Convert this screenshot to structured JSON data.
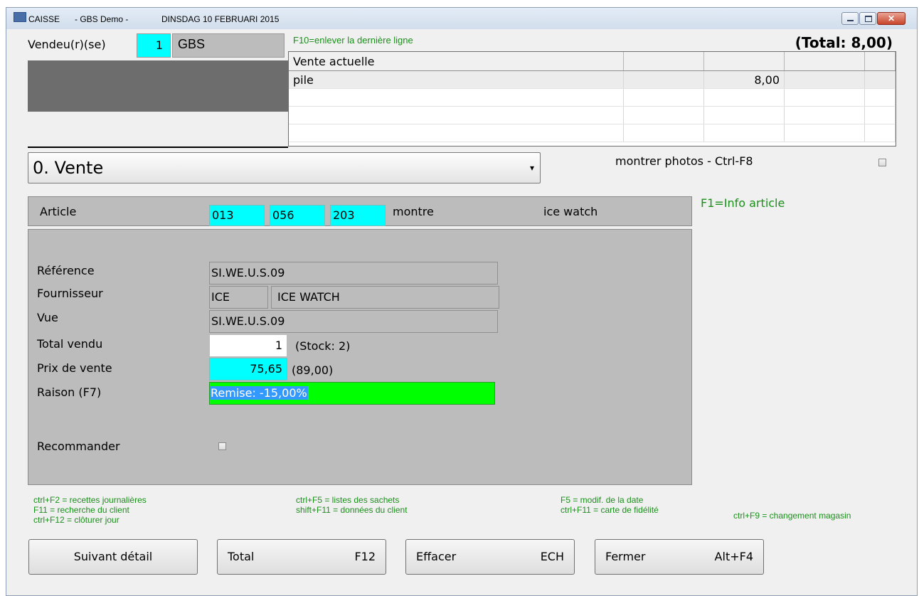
{
  "window": {
    "app": "CAISSE",
    "company": "- GBS Demo -",
    "date": "DINSDAG 10 FEBRUARI 2015"
  },
  "header": {
    "vendeur_label": "Vendeu(r)(se)",
    "vendeur_number": "1",
    "vendeur_name": "GBS",
    "f10_hint": "F10=enlever la dernière ligne",
    "total": "(Total: 8,00)"
  },
  "sale_grid": {
    "header": "Vente actuelle",
    "rows": [
      {
        "item": "pile",
        "amount": "8,00"
      }
    ]
  },
  "category": {
    "selected": "0. Vente"
  },
  "photos": {
    "label": "montrer photos - Ctrl-F8",
    "checked": false
  },
  "article": {
    "label": "Article",
    "code1": "013",
    "code2": "056",
    "code3": "203",
    "type": "montre",
    "brand": "ice watch",
    "info_hint": "F1=Info article"
  },
  "detail": {
    "reference_label": "Référence",
    "reference": "SI.WE.U.S.09",
    "supplier_label": "Fournisseur",
    "supplier_code": "ICE",
    "supplier_name": "ICE WATCH",
    "view_label": "Vue",
    "view": "SI.WE.U.S.09",
    "total_sold_label": "Total vendu",
    "total_sold": "1",
    "stock": "(Stock: 2)",
    "price_label": "Prix de vente",
    "price": "75,65",
    "original_price": "(89,00)",
    "reason_label": "Raison (F7)",
    "reason": "Remise: -15,00%",
    "recommend_label": "Recommander",
    "recommend_checked": false
  },
  "hints": {
    "col1": [
      "ctrl+F2 = recettes journalières",
      "F11 = recherche du client",
      "ctrl+F12 = clôturer jour"
    ],
    "col2": [
      "ctrl+F5 = listes des sachets",
      "shift+F11 = données du client"
    ],
    "col3": [
      "F5 = modif. de la date",
      "ctrl+F11 = carte de fidélité"
    ],
    "col4": [
      "ctrl+F9 = changement magasin"
    ]
  },
  "buttons": {
    "next_detail": "Suivant détail",
    "total": "Total",
    "total_key": "F12",
    "erase": "Effacer",
    "erase_key": "ECH",
    "close": "Fermer",
    "close_key": "Alt+F4"
  },
  "colors": {
    "cyan_field": "#00ffff",
    "reason_green": "#00ff00",
    "panel_gray": "#bcbcbc",
    "hint_green": "#1b8f1b"
  }
}
